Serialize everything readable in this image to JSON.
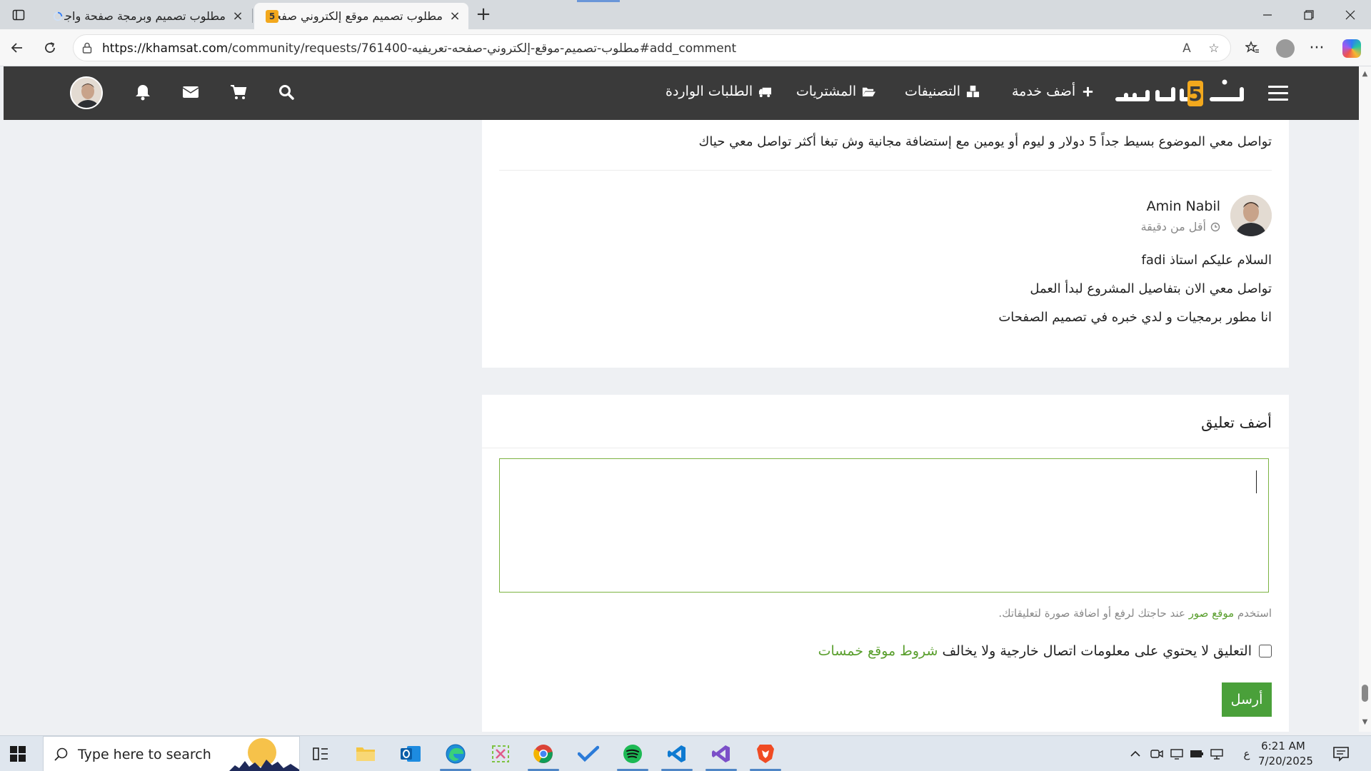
{
  "browser": {
    "tabs": [
      {
        "title": "مطلوب تصميم وبرمجة صفحة واجهة",
        "active": false
      },
      {
        "title": "مطلوب تصميم موقع إلكتروني صفحة",
        "active": true
      }
    ],
    "url_domain": "https://khamsat.com",
    "url_path": "/community/requests/761400-مطلوب-تصميم-موقع-إلكتروني-صفحه-تعريفيه#add_comment",
    "favicon_label": "5"
  },
  "site": {
    "logo_text": "خمسات",
    "menu": {
      "add_service": "أضف خدمة",
      "categories": "التصنيفات",
      "purchases": "المشتريات",
      "incoming_requests": "الطلبات الواردة"
    }
  },
  "thread": {
    "previous_comment": "تواصل معي الموضوع بسيط جداً 5 دولار و ليوم أو يومين مع إستضافة مجانية وش تبغا أكثر تواصل معي حياك",
    "comment": {
      "author": "Amin Nabil",
      "time": "أقل من دقيقة",
      "lines": [
        "السلام عليكم استاذ fadi",
        "تواصل معي الان بتفاصيل المشروع لبدأ العمل",
        "انا مطور برمجيات و لدي خبره في تصميم الصفحات"
      ]
    }
  },
  "add_comment": {
    "title": "أضف تعليق",
    "textarea_value": "",
    "hint_before": "استخدم ",
    "hint_link": "موقع صور",
    "hint_after": " عند حاجتك لرفع أو اضافة صورة لتعليقاتك.",
    "terms_text": "التعليق لا يحتوي على معلومات اتصال خارجية ولا يخالف ",
    "terms_link": "شروط موقع خمسات",
    "terms_checked": false,
    "send_label": "أرسل"
  },
  "colors": {
    "header_bg": "#3a3a3a",
    "accent_green": "#4aa03a",
    "logo_orange": "#f2a81d"
  },
  "taskbar": {
    "search_placeholder": "Type here to search",
    "time": "6:21 AM",
    "date": "7/20/2025",
    "ime": "ع",
    "apps": [
      "task-view",
      "file-explorer",
      "outlook",
      "edge",
      "snipping-tool",
      "chrome",
      "todo",
      "spotify",
      "vscode",
      "visual-studio",
      "brave"
    ]
  }
}
